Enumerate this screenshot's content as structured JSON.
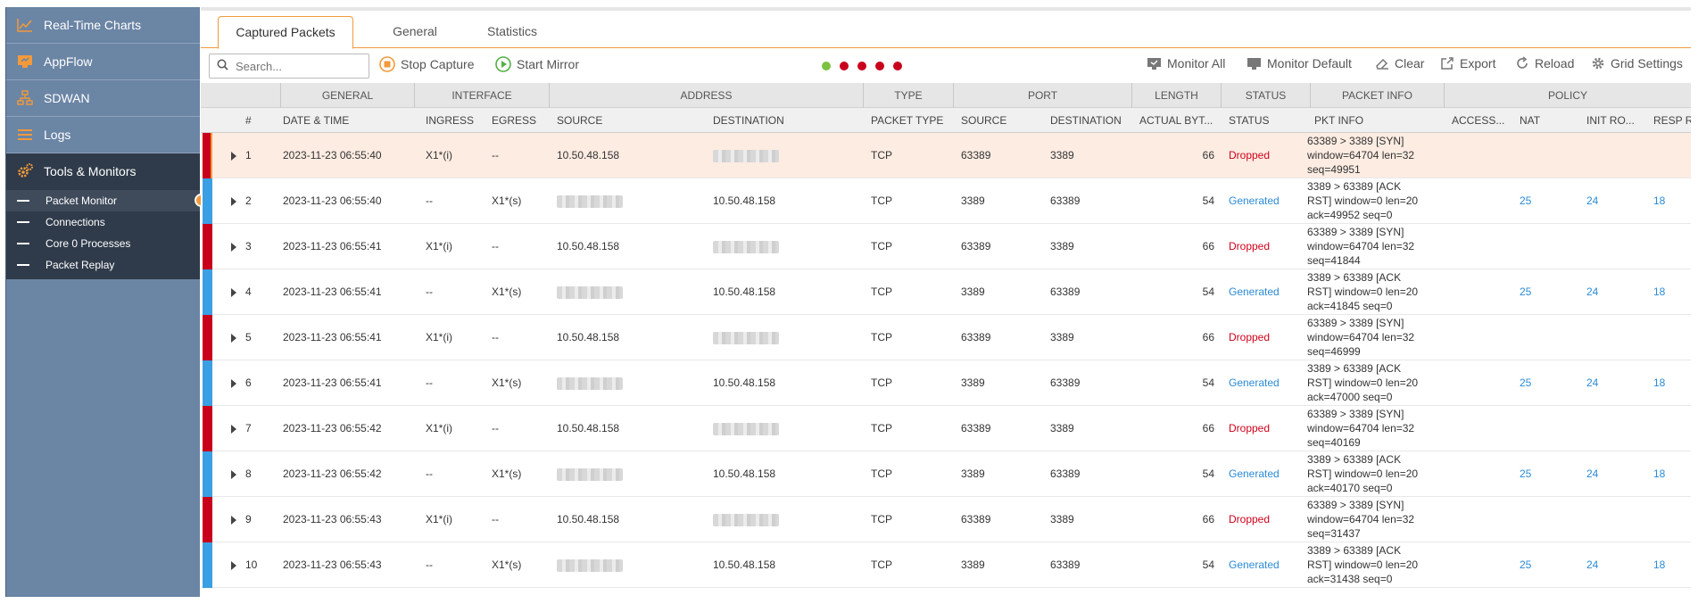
{
  "colors": {
    "accent": "#f29a3b",
    "dropped_bar": "#c8001b",
    "generated_bar": "#3a9fe3",
    "dropped_text": "#d0021b",
    "generated_text": "#2b8bd6"
  },
  "sidebar": {
    "items": [
      {
        "label": "Real-Time Charts",
        "icon": "chart-icon"
      },
      {
        "label": "AppFlow",
        "icon": "appflow-icon"
      },
      {
        "label": "SDWAN",
        "icon": "sdwan-icon"
      },
      {
        "label": "Logs",
        "icon": "logs-icon"
      },
      {
        "label": "Tools & Monitors",
        "icon": "tools-icon"
      }
    ],
    "subitems": [
      "Packet Monitor",
      "Connections",
      "Core 0 Processes",
      "Packet Replay"
    ]
  },
  "tabs": [
    "Captured Packets",
    "General",
    "Statistics"
  ],
  "toolbar": {
    "search_placeholder": "Search...",
    "stop_capture": "Stop Capture",
    "start_mirror": "Start Mirror",
    "monitor_all": "Monitor All",
    "monitor_default": "Monitor Default",
    "clear": "Clear",
    "export": "Export",
    "reload": "Reload",
    "grid_settings": "Grid Settings",
    "status_dots": [
      "#7cc242",
      "#c8001b",
      "#c8001b",
      "#c8001b",
      "#c8001b"
    ]
  },
  "groups": {
    "general": "GENERAL",
    "interface": "INTERFACE",
    "address": "ADDRESS",
    "type": "TYPE",
    "port": "PORT",
    "length": "LENGTH",
    "status": "STATUS",
    "packet_info": "PACKET INFO",
    "policy": "POLICY"
  },
  "columns": {
    "num": "#",
    "datetime": "DATE & TIME",
    "ingress": "INGRESS",
    "egress": "EGRESS",
    "src": "SOURCE",
    "dst": "DESTINATION",
    "ptype": "PACKET TYPE",
    "sport": "SOURCE",
    "dport": "DESTINATION",
    "len": "ACTUAL BYT...",
    "status": "STATUS",
    "pkt": "PKT INFO",
    "access": "ACCESS...",
    "nat": "NAT",
    "init": "INIT RO...",
    "resp": "RESP R..."
  },
  "rows": [
    {
      "num": "1",
      "datetime": "2023-11-23 06:55:40",
      "ingress": "X1*(i)",
      "egress": "--",
      "src": "10.50.48.158",
      "dst": "",
      "ptype": "TCP",
      "sport": "63389",
      "dport": "3389",
      "len": "66",
      "status": "Dropped",
      "pkt": "63389 > 3389 [SYN] window=64704 len=32 seq=49951",
      "nat": "",
      "init": "",
      "resp": ""
    },
    {
      "num": "2",
      "datetime": "2023-11-23 06:55:40",
      "ingress": "--",
      "egress": "X1*(s)",
      "src": "",
      "dst": "10.50.48.158",
      "ptype": "TCP",
      "sport": "3389",
      "dport": "63389",
      "len": "54",
      "status": "Generated",
      "pkt": "3389 > 63389 [ACK RST] window=0 len=20 ack=49952 seq=0",
      "nat": "25",
      "init": "24",
      "resp": "18"
    },
    {
      "num": "3",
      "datetime": "2023-11-23 06:55:41",
      "ingress": "X1*(i)",
      "egress": "--",
      "src": "10.50.48.158",
      "dst": "",
      "ptype": "TCP",
      "sport": "63389",
      "dport": "3389",
      "len": "66",
      "status": "Dropped",
      "pkt": "63389 > 3389 [SYN] window=64704 len=32 seq=41844",
      "nat": "",
      "init": "",
      "resp": ""
    },
    {
      "num": "4",
      "datetime": "2023-11-23 06:55:41",
      "ingress": "--",
      "egress": "X1*(s)",
      "src": "",
      "dst": "10.50.48.158",
      "ptype": "TCP",
      "sport": "3389",
      "dport": "63389",
      "len": "54",
      "status": "Generated",
      "pkt": "3389 > 63389 [ACK RST] window=0 len=20 ack=41845 seq=0",
      "nat": "25",
      "init": "24",
      "resp": "18"
    },
    {
      "num": "5",
      "datetime": "2023-11-23 06:55:41",
      "ingress": "X1*(i)",
      "egress": "--",
      "src": "10.50.48.158",
      "dst": "",
      "ptype": "TCP",
      "sport": "63389",
      "dport": "3389",
      "len": "66",
      "status": "Dropped",
      "pkt": "63389 > 3389 [SYN] window=64704 len=32 seq=46999",
      "nat": "",
      "init": "",
      "resp": ""
    },
    {
      "num": "6",
      "datetime": "2023-11-23 06:55:41",
      "ingress": "--",
      "egress": "X1*(s)",
      "src": "",
      "dst": "10.50.48.158",
      "ptype": "TCP",
      "sport": "3389",
      "dport": "63389",
      "len": "54",
      "status": "Generated",
      "pkt": "3389 > 63389 [ACK RST] window=0 len=20 ack=47000 seq=0",
      "nat": "25",
      "init": "24",
      "resp": "18"
    },
    {
      "num": "7",
      "datetime": "2023-11-23 06:55:42",
      "ingress": "X1*(i)",
      "egress": "--",
      "src": "10.50.48.158",
      "dst": "",
      "ptype": "TCP",
      "sport": "63389",
      "dport": "3389",
      "len": "66",
      "status": "Dropped",
      "pkt": "63389 > 3389 [SYN] window=64704 len=32 seq=40169",
      "nat": "",
      "init": "",
      "resp": ""
    },
    {
      "num": "8",
      "datetime": "2023-11-23 06:55:42",
      "ingress": "--",
      "egress": "X1*(s)",
      "src": "",
      "dst": "10.50.48.158",
      "ptype": "TCP",
      "sport": "3389",
      "dport": "63389",
      "len": "54",
      "status": "Generated",
      "pkt": "3389 > 63389 [ACK RST] window=0 len=20 ack=40170 seq=0",
      "nat": "25",
      "init": "24",
      "resp": "18"
    },
    {
      "num": "9",
      "datetime": "2023-11-23 06:55:43",
      "ingress": "X1*(i)",
      "egress": "--",
      "src": "10.50.48.158",
      "dst": "",
      "ptype": "TCP",
      "sport": "63389",
      "dport": "3389",
      "len": "66",
      "status": "Dropped",
      "pkt": "63389 > 3389 [SYN] window=64704 len=32 seq=31437",
      "nat": "",
      "init": "",
      "resp": ""
    },
    {
      "num": "10",
      "datetime": "2023-11-23 06:55:43",
      "ingress": "--",
      "egress": "X1*(s)",
      "src": "",
      "dst": "10.50.48.158",
      "ptype": "TCP",
      "sport": "3389",
      "dport": "63389",
      "len": "54",
      "status": "Generated",
      "pkt": "3389 > 63389 [ACK RST] window=0 len=20 ack=31438 seq=0",
      "nat": "25",
      "init": "24",
      "resp": "18"
    }
  ]
}
